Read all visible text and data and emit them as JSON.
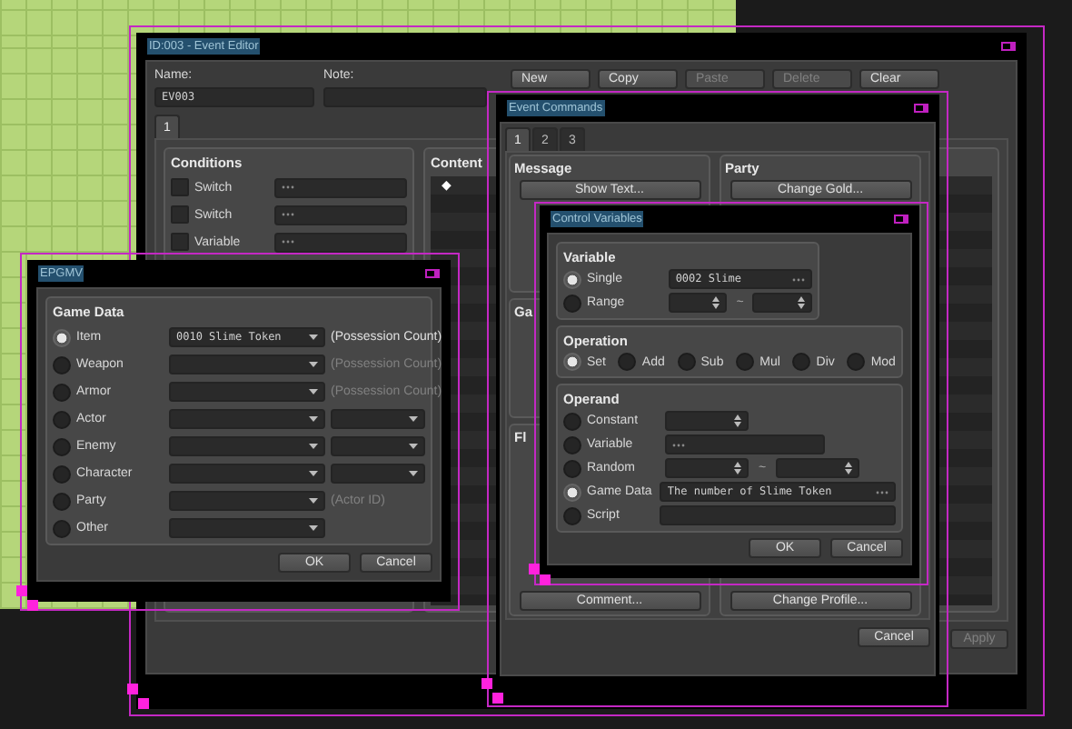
{
  "event_editor": {
    "title": "ID:003 - Event Editor",
    "name_label": "Name:",
    "name_value": "EV003",
    "note_label": "Note:",
    "toolbar": [
      {
        "label": "New",
        "disabled": false
      },
      {
        "label": "Copy",
        "disabled": false
      },
      {
        "label": "Paste",
        "disabled": true
      },
      {
        "label": "Delete",
        "disabled": true
      },
      {
        "label": "Clear",
        "disabled": false
      }
    ],
    "tabs": [
      {
        "label": "1",
        "selected": true
      }
    ],
    "conditions": {
      "title": "Conditions",
      "items": [
        {
          "label": "Switch",
          "checked": false
        },
        {
          "label": "Switch",
          "checked": false
        },
        {
          "label": "Variable",
          "checked": false
        }
      ]
    },
    "contents": {
      "title": "Content",
      "lines": [
        "◆"
      ]
    },
    "buttons": [
      {
        "label": "Apply",
        "disabled": true
      }
    ]
  },
  "event_commands": {
    "title": "Event Commands",
    "tabs": [
      {
        "label": "1",
        "selected": true
      },
      {
        "label": "2",
        "selected": false
      },
      {
        "label": "3",
        "selected": false
      }
    ],
    "left_panels": [
      {
        "title": "Message",
        "top_button": "Show Text..."
      },
      {
        "title": "Ga"
      },
      {
        "title": "Fl",
        "bottom_button": "Comment..."
      }
    ],
    "right_panels": [
      {
        "title": "Party",
        "top_button": "Change Gold...",
        "bottom_button": "Change Profile..."
      }
    ],
    "buttons": [
      "Cancel"
    ]
  },
  "control_variables": {
    "title": "Control Variables",
    "variable": {
      "title": "Variable",
      "options": [
        {
          "label": "Single",
          "selected": true,
          "kind": "select",
          "value": "0002 Slime"
        },
        {
          "label": "Range",
          "selected": false,
          "kind": "range",
          "separator": "~"
        }
      ]
    },
    "operation": {
      "title": "Operation",
      "options": [
        {
          "label": "Set",
          "selected": true
        },
        {
          "label": "Add",
          "selected": false
        },
        {
          "label": "Sub",
          "selected": false
        },
        {
          "label": "Mul",
          "selected": false
        },
        {
          "label": "Div",
          "selected": false
        },
        {
          "label": "Mod",
          "selected": false
        }
      ]
    },
    "operand": {
      "title": "Operand",
      "options": [
        {
          "label": "Constant",
          "selected": false,
          "kind": "spin"
        },
        {
          "label": "Variable",
          "selected": false,
          "kind": "select"
        },
        {
          "label": "Random",
          "selected": false,
          "kind": "range",
          "separator": "~"
        },
        {
          "label": "Game Data",
          "selected": true,
          "kind": "select",
          "value": "The number of Slime Token",
          "wide": true
        },
        {
          "label": "Script",
          "selected": false,
          "kind": "text"
        }
      ]
    },
    "buttons": [
      "OK",
      "Cancel"
    ]
  },
  "game_data": {
    "title": "EPGMV",
    "group_title": "Game Data",
    "rows": [
      {
        "label": "Item",
        "selected": true,
        "value": "0010 Slime Token",
        "extra": {
          "kind": "note",
          "text": "(Possession Count)",
          "disabled": false
        }
      },
      {
        "label": "Weapon",
        "selected": false,
        "extra": {
          "kind": "note",
          "text": "(Possession Count)",
          "disabled": true
        }
      },
      {
        "label": "Armor",
        "selected": false,
        "extra": {
          "kind": "note",
          "text": "(Possession Count)",
          "disabled": true
        }
      },
      {
        "label": "Actor",
        "selected": false,
        "extra": {
          "kind": "dropdown"
        }
      },
      {
        "label": "Enemy",
        "selected": false,
        "extra": {
          "kind": "dropdown"
        }
      },
      {
        "label": "Character",
        "selected": false,
        "extra": {
          "kind": "dropdown"
        }
      },
      {
        "label": "Party",
        "selected": false,
        "extra": {
          "kind": "note",
          "text": "(Actor ID)",
          "disabled": true
        }
      },
      {
        "label": "Other",
        "selected": false
      }
    ],
    "buttons": [
      "OK",
      "Cancel"
    ]
  }
}
